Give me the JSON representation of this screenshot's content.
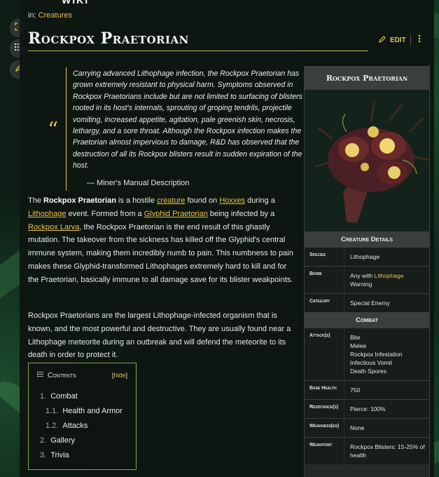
{
  "header": {
    "wiki_label": "WIKI",
    "breadcrumb_prefix": "in:",
    "breadcrumb_link": "Creatures",
    "page_title": "Rockpox Praetorian",
    "edit_label": "EDIT"
  },
  "quote": {
    "text": "Carrying advanced Lithophage infection, the Rockpox Praetorian has grown extremely resistant to physical harm. Symptoms observed in Rockpox Praetorians include but are not limited to surfacing of blisters rooted in its host's internals, sprouting of groping tendrils, projectile vomiting, increased appetite, agitation, pale greenish skin, necrosis, lethargy, and a sore throat. Although the Rockpox infection makes the Praetorian almost impervious to damage, R&D has observed that the destruction of all its Rockpox blisters result in sudden expiration of the host.",
    "attribution": "— Miner's Manual Description"
  },
  "intro": {
    "p1": {
      "s1": "The ",
      "bold": "Rockpox Praetorian",
      "s2": " is a hostile ",
      "link_creature": "creature",
      "s3": " found on ",
      "link_hoxxes": "Hoxxes",
      "s4": " during a ",
      "link_lithophage": "Lithophage",
      "s5": " event. Formed from a ",
      "link_glyphid": "Glyphid Praetorian",
      "s6": " being infected by a ",
      "link_larva": "Rockpox Larva",
      "s7": ", the Rockpox Praetorian is the end result of this ghastly mutation. The takeover from the sickness has killed off the Glyphid's central immune system, making them incredibly numb to pain. This numbness to pain makes these Glyphid-transformed Lithophages extremely hard to kill and for the Praetorian, basically immune to all damage save for its blister weakpoints."
    },
    "p2": "Rockpox Praetorians are the largest Lithophage-infected organism that is known, and the most powerful and destructive. They are usually found near a Lithophage meteorite during an outbreak and will defend the meteorite to its death in order to protect it."
  },
  "toc": {
    "title": "Contents",
    "hide_open": "[",
    "hide_label": "hide",
    "hide_close": "]",
    "items": [
      {
        "num": "1.",
        "label": "Combat"
      },
      {
        "num": "1.1.",
        "label": "Health and Armor"
      },
      {
        "num": "1.2.",
        "label": "Attacks"
      },
      {
        "num": "2.",
        "label": "Gallery"
      },
      {
        "num": "3.",
        "label": "Trivia"
      }
    ]
  },
  "infobox": {
    "title": "Rockpox Praetorian",
    "section_details": "Creature Details",
    "species_label": "Species",
    "species_value": "Lithophage",
    "biome_label": "Biome",
    "biome_prefix": "Any with ",
    "biome_link": "Lithophage",
    "biome_suffix": "Warning",
    "category_label": "Category",
    "category_value": "Special Enemy",
    "section_combat": "Combat",
    "attacks_label": "Attack(s)",
    "attacks": [
      "Bite",
      "Melee",
      "Rockpox Infestation",
      "Infectious Vomit",
      "Death Spores"
    ],
    "health_label": "Base Health",
    "health_value": "750",
    "resist_label": "Resistance(s)",
    "resist_value": "Pierce: 100%",
    "weak_label": "Weakness(es)",
    "weak_value": "None",
    "weakpoint_label": "Weakpoint",
    "weakpoint_value": "Rockpox Blisters: 15-25% of health"
  },
  "colors": {
    "accent": "#e8c14a",
    "toc_border": "#86a548"
  }
}
